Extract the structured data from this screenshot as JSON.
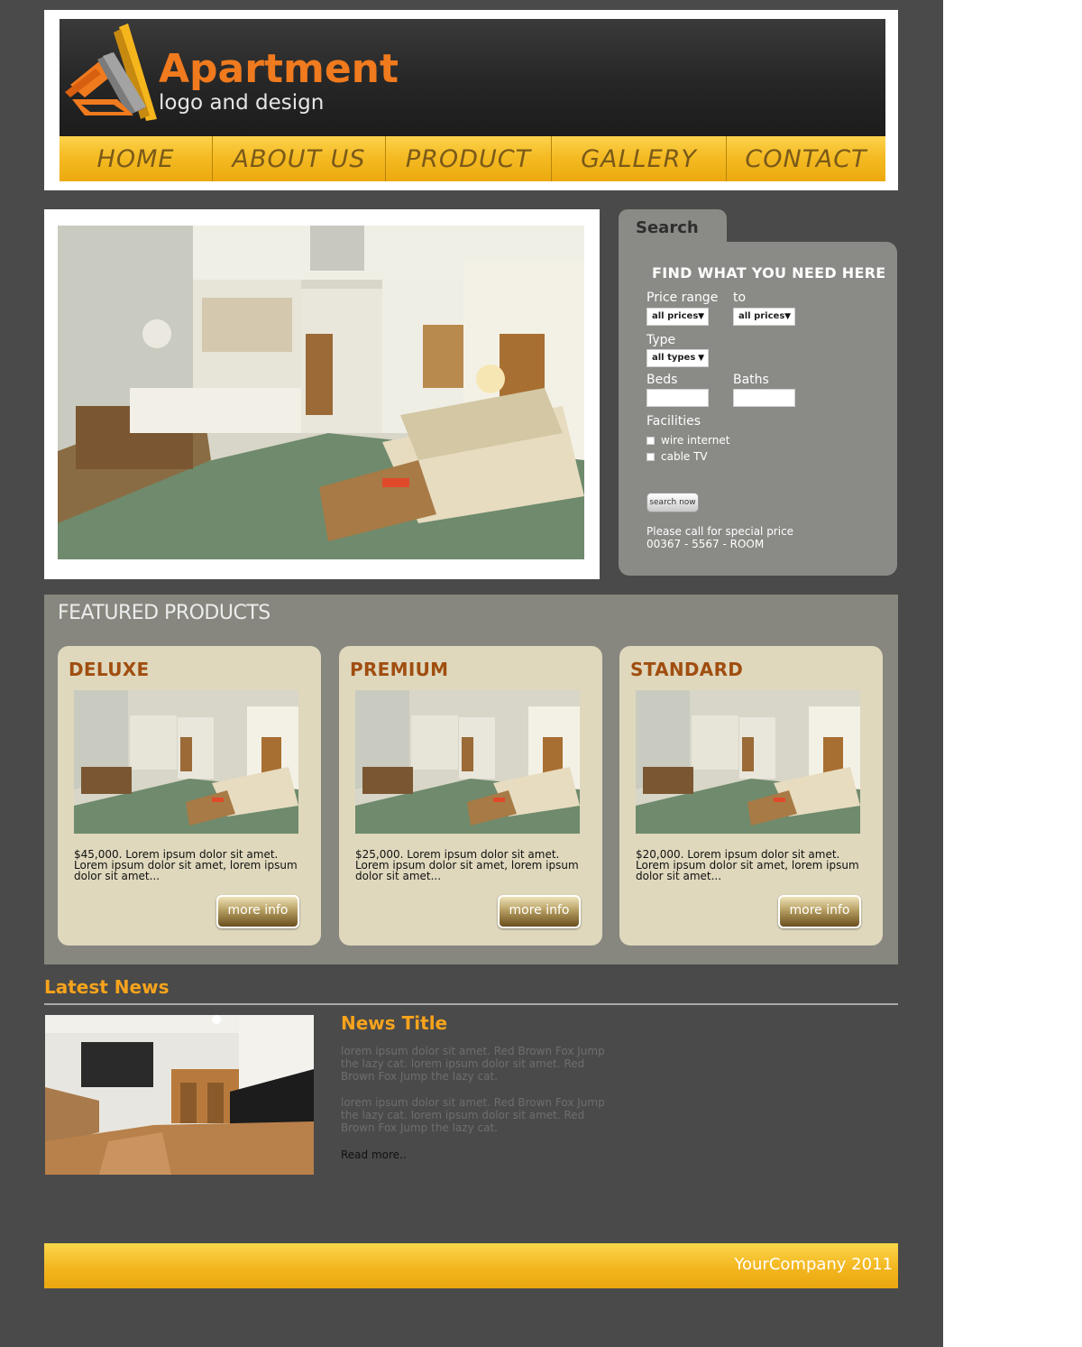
{
  "logo": {
    "title": "Apartment",
    "subtitle": "logo and design"
  },
  "nav": {
    "items": [
      "HOME",
      "ABOUT US",
      "PRODUCT",
      "GALLERY",
      "CONTACT"
    ]
  },
  "search": {
    "tab_label": "Search",
    "panel_title": "FIND WHAT YOU NEED HERE",
    "price_range_label": "Price range",
    "to_label": "to",
    "price_from_value": "all prices",
    "price_to_value": "all prices",
    "type_label": "Type",
    "type_value": "all types",
    "beds_label": "Beds",
    "baths_label": "Baths",
    "facilities_label": "Facilities",
    "facilities": [
      "wire internet",
      "cable TV"
    ],
    "button_label": "search now",
    "note_line1": "Please call for special price",
    "note_line2": "00367 - 5567 - ROOM"
  },
  "featured": {
    "title": "FEATURED PRODUCTS",
    "cards": [
      {
        "title": "DELUXE",
        "desc": "$45,000. Lorem ipsum dolor sit amet. Lorem ipsum dolor sit amet, lorem ipsum dolor sit amet...",
        "button": "more info"
      },
      {
        "title": "PREMIUM",
        "desc": "$25,000. Lorem ipsum dolor sit amet. Lorem ipsum dolor sit amet, lorem ipsum dolor sit amet...",
        "button": "more info"
      },
      {
        "title": "STANDARD",
        "desc": "$20,000. Lorem ipsum dolor sit amet. Lorem ipsum dolor sit amet, lorem ipsum dolor sit amet...",
        "button": "more info"
      }
    ]
  },
  "news": {
    "heading": "Latest News",
    "title": "News Title",
    "paragraph1": "lorem ipsum dolor sit amet. Red Brown Fox Jump the lazy cat. lorem ipsum dolor sit amet. Red Brown Fox Jump the lazy cat.",
    "paragraph2": "lorem ipsum dolor sit amet. Red Brown Fox Jump the lazy cat. lorem ipsum dolor sit amet. Red Brown Fox Jump the lazy cat.",
    "read_more": "Read more.."
  },
  "footer": {
    "text": "YourCompany 2011"
  },
  "colors": {
    "accent_orange": "#f7a31c",
    "nav_gold": "#f5bb24",
    "page_bg": "#4a4a4a",
    "card_bg": "#dfd8bd"
  }
}
